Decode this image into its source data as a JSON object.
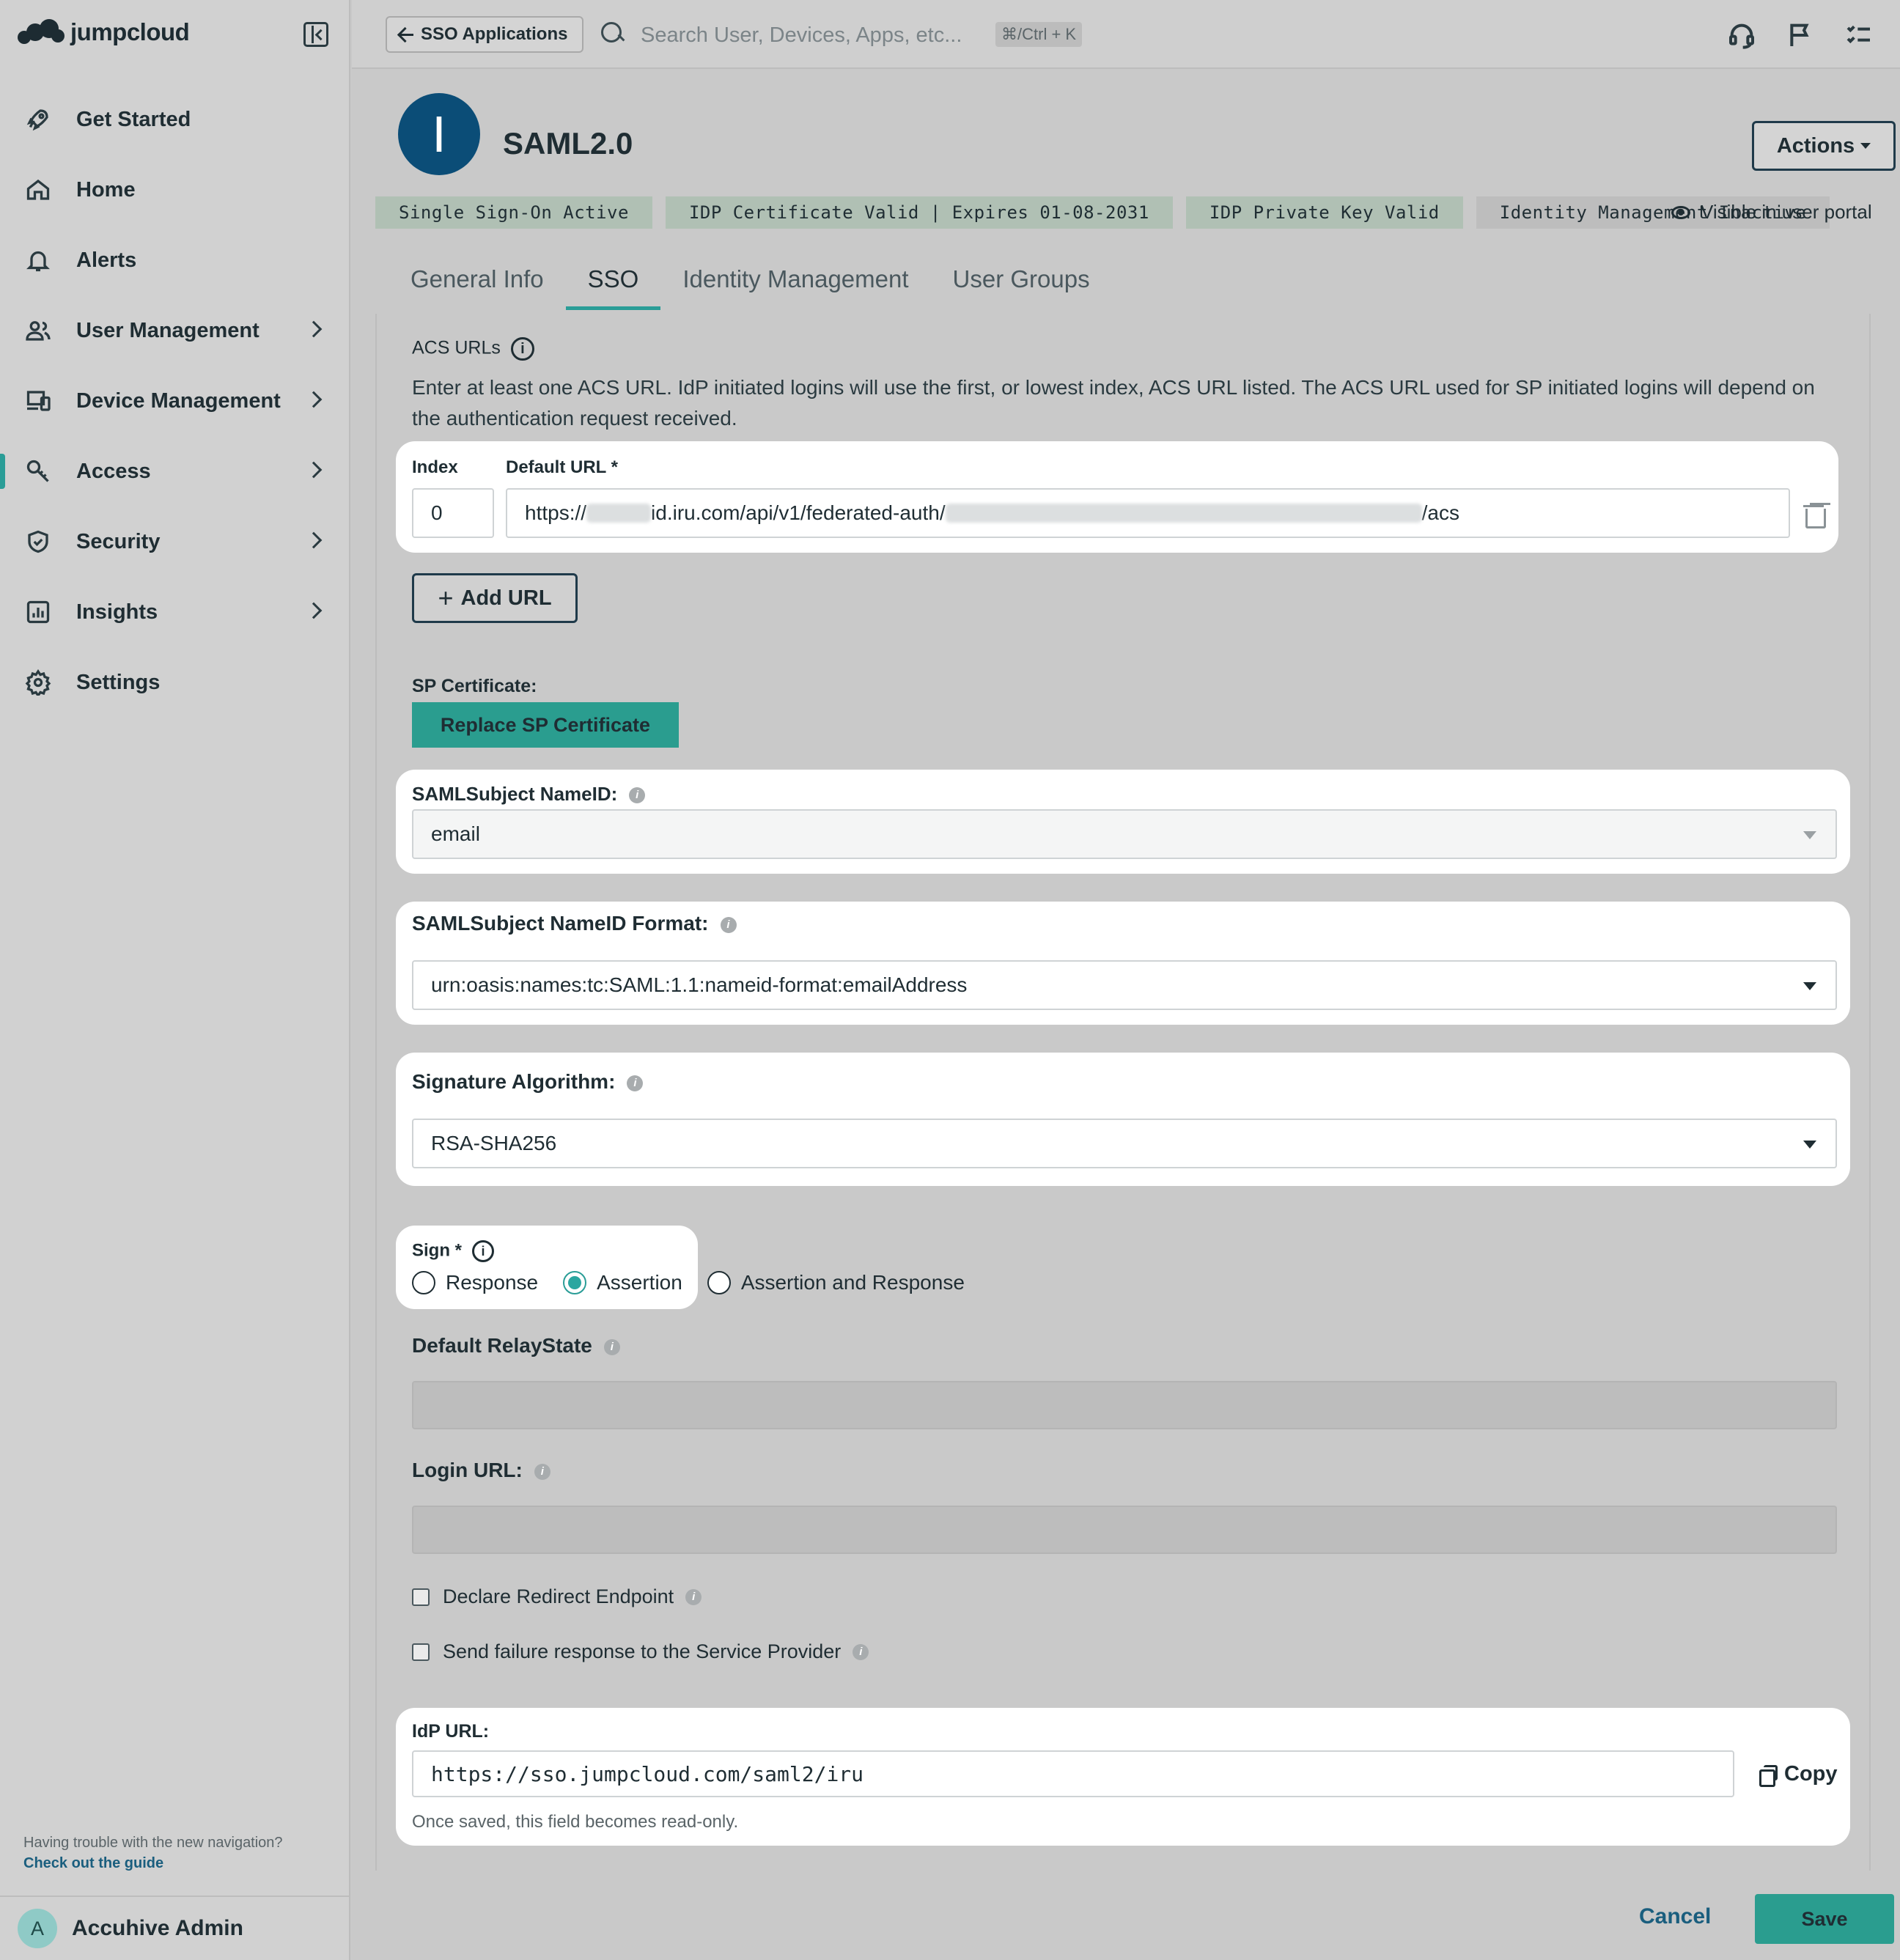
{
  "app": {
    "brand": "jumpcloud"
  },
  "sidebar": {
    "items": [
      {
        "label": "Get Started",
        "icon": "rocket-icon"
      },
      {
        "label": "Home",
        "icon": "home-icon"
      },
      {
        "label": "Alerts",
        "icon": "bell-icon"
      },
      {
        "label": "User Management",
        "icon": "users-icon",
        "expandable": true
      },
      {
        "label": "Device Management",
        "icon": "devices-icon",
        "expandable": true
      },
      {
        "label": "Access",
        "icon": "key-icon",
        "expandable": true,
        "active": true
      },
      {
        "label": "Security",
        "icon": "shield-icon",
        "expandable": true
      },
      {
        "label": "Insights",
        "icon": "chart-icon",
        "expandable": true
      },
      {
        "label": "Settings",
        "icon": "gear-icon"
      }
    ],
    "help_text": "Having trouble with the new navigation?",
    "help_link": "Check out the guide",
    "user": {
      "initial": "A",
      "name": "Accuhive Admin"
    }
  },
  "topbar": {
    "back_label": "SSO Applications",
    "search_placeholder": "Search User, Devices, Apps, etc...",
    "shortcut": "⌘/Ctrl + K"
  },
  "header": {
    "avatar_letter": "I",
    "title": "SAML2.0",
    "actions_label": "Actions",
    "badges": [
      {
        "label": "Single Sign-On Active",
        "state": "active"
      },
      {
        "label": "IDP Certificate Valid | Expires 01-08-2031",
        "state": "active"
      },
      {
        "label": "IDP Private Key Valid",
        "state": "active"
      },
      {
        "label": "Identity Management Inactive",
        "state": "inactive"
      }
    ],
    "visible_label": "Visible in user portal"
  },
  "tabs": [
    {
      "label": "General Info",
      "active": false
    },
    {
      "label": "SSO",
      "active": true
    },
    {
      "label": "Identity Management",
      "active": false
    },
    {
      "label": "User Groups",
      "active": false
    }
  ],
  "sso": {
    "acs_title": "ACS URLs",
    "acs_description": "Enter at least one ACS URL. IdP initiated logins will use the first, or lowest index, ACS URL listed. The ACS URL used for SP initiated logins will depend on the authentication request received.",
    "index_label": "Index",
    "default_url_label": "Default URL *",
    "index_value": "0",
    "url_prefix": "https://",
    "url_middle": "id.iru.com/api/v1/federated-auth/",
    "url_suffix": "/acs",
    "add_url_label": "Add URL",
    "sp_cert_label": "SP Certificate:",
    "replace_cert_label": "Replace SP Certificate",
    "nameid_label": "SAMLSubject NameID:",
    "nameid_value": "email",
    "nameid_format_label": "SAMLSubject NameID Format:",
    "nameid_format_value": "urn:oasis:names:tc:SAML:1.1:nameid-format:emailAddress",
    "sig_alg_label": "Signature Algorithm:",
    "sig_alg_value": "RSA-SHA256",
    "sign_label": "Sign *",
    "sign_options": [
      {
        "label": "Response",
        "checked": false
      },
      {
        "label": "Assertion",
        "checked": true
      },
      {
        "label": "Assertion and Response",
        "checked": false
      }
    ],
    "relay_state_label": "Default RelayState",
    "login_url_label": "Login URL:",
    "declare_redirect_label": "Declare Redirect Endpoint",
    "send_failure_label": "Send failure response to the Service Provider",
    "idp_url_label": "IdP URL:",
    "idp_url_value": "https://sso.jumpcloud.com/saml2/iru",
    "copy_label": "Copy",
    "idp_helper": "Once saved, this field becomes read-only."
  },
  "footer": {
    "cancel_label": "Cancel",
    "save_label": "Save"
  },
  "colors": {
    "accent": "#2a9d97",
    "brand_dark": "#0b4d77",
    "link": "#1a5e7e",
    "badge": "#b0c0b4"
  }
}
